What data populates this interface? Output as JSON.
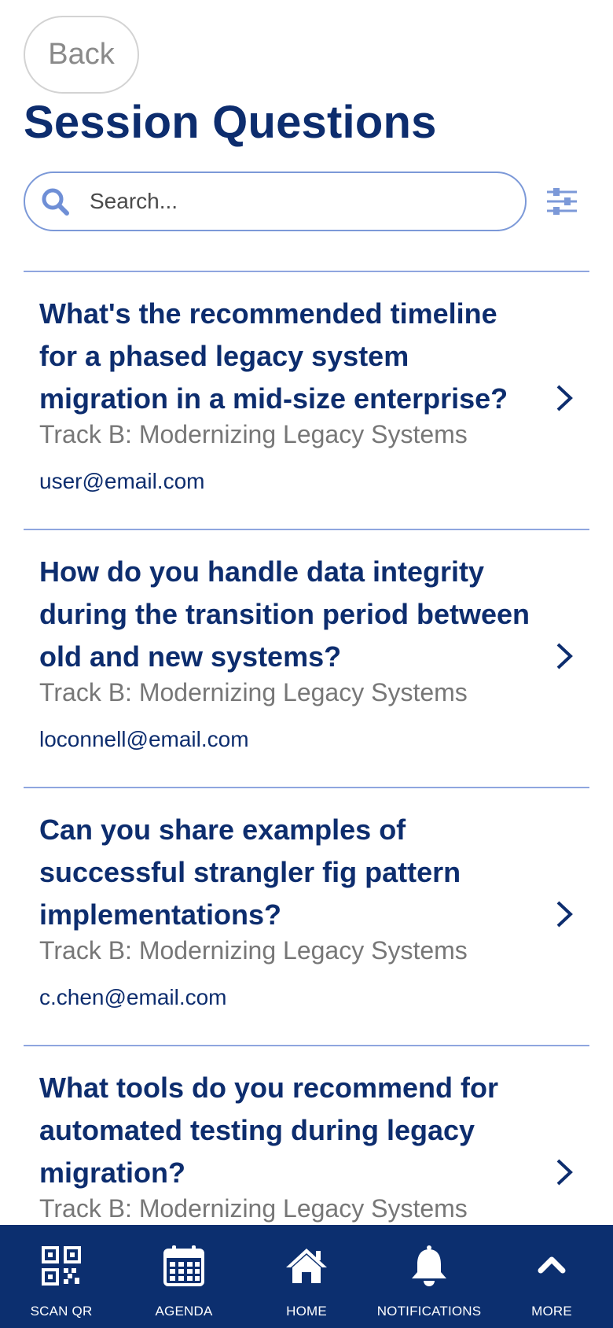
{
  "header": {
    "back_label": "Back",
    "title": "Session Questions"
  },
  "search": {
    "placeholder": "Search...",
    "value": ""
  },
  "questions": [
    {
      "text": "What's the recommended timeline for a phased legacy system migration in a mid-size enterprise?",
      "track": "Track B: Modernizing Legacy Systems",
      "email": "user@email.com"
    },
    {
      "text": "How do you handle data integrity during the transition period between old and new systems?",
      "track": "Track B: Modernizing Legacy Systems",
      "email": "loconnell@email.com"
    },
    {
      "text": "Can you share examples of successful strangler fig pattern implementations?",
      "track": "Track B: Modernizing Legacy Systems",
      "email": "c.chen@email.com"
    },
    {
      "text": "What tools do you recommend for automated testing during legacy migration?",
      "track": "Track B: Modernizing Legacy Systems",
      "email": ""
    }
  ],
  "tabbar": {
    "items": [
      {
        "label": "SCAN QR",
        "icon": "qr-code-icon"
      },
      {
        "label": "AGENDA",
        "icon": "calendar-icon"
      },
      {
        "label": "HOME",
        "icon": "home-icon"
      },
      {
        "label": "NOTIFICATIONS",
        "icon": "bell-icon"
      },
      {
        "label": "MORE",
        "icon": "chevron-up-icon"
      }
    ]
  },
  "colors": {
    "primary": "#0d2d6e",
    "tabbar_bg": "#0c2f6f",
    "accent_light": "#7c99d8",
    "muted_text": "#777777"
  }
}
